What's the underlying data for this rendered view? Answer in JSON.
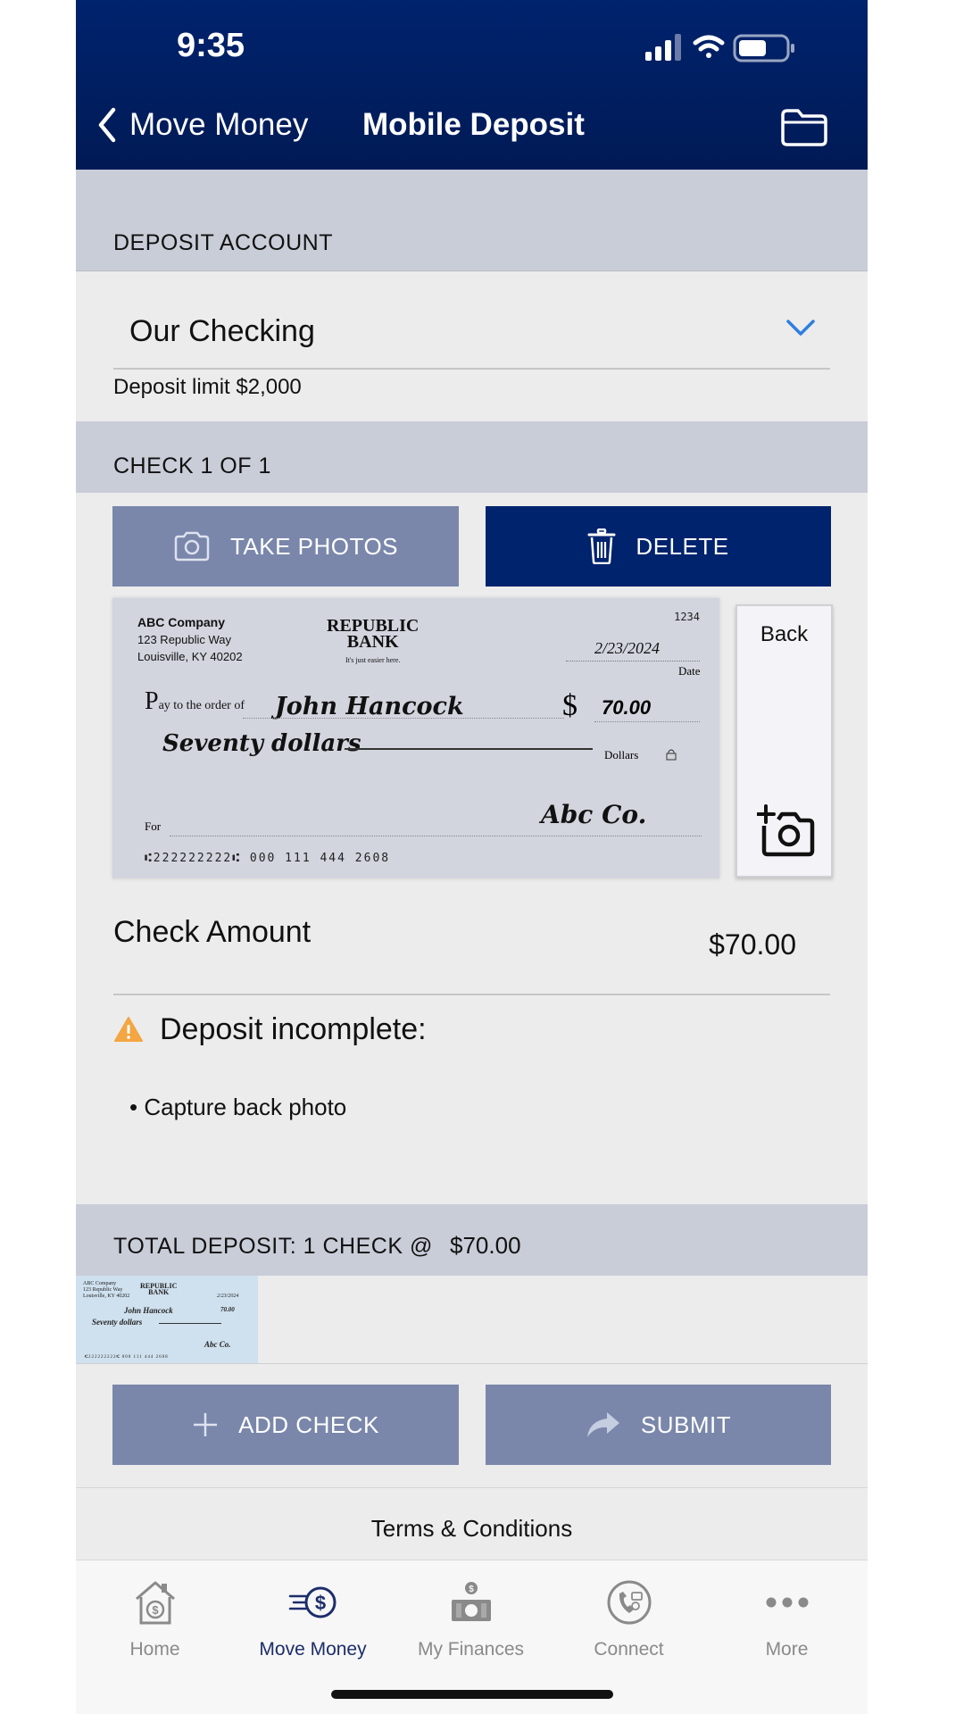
{
  "status_bar": {
    "time": "9:35"
  },
  "nav": {
    "back_label": "Move Money",
    "title": "Mobile Deposit"
  },
  "deposit_account": {
    "section_label": "DEPOSIT ACCOUNT",
    "selected_account": "Our Checking",
    "deposit_limit": "Deposit limit $2,000"
  },
  "check_section": {
    "label": "CHECK 1 OF 1"
  },
  "buttons": {
    "take_photos": "TAKE PHOTOS",
    "delete": "DELETE",
    "add_check": "ADD CHECK",
    "submit": "SUBMIT"
  },
  "check_image": {
    "company_name": "ABC Company",
    "address_line1": "123 Republic Way",
    "address_line2": "Louisville, KY 40202",
    "bank_name_line1": "REPUBLIC",
    "bank_name_line2": "BANK",
    "bank_tagline": "It's just easier here.",
    "check_number": "1234",
    "date": "2/23/2024",
    "date_label": "Date",
    "pay_prefix": "P",
    "pay_to_label": "ay to the order of",
    "payee": "John Hancock",
    "currency_symbol": "$",
    "amount": "70.00",
    "amount_words": "Seventy dollars",
    "dollars_label": "Dollars",
    "for_label": "For",
    "signature": "Abc Co.",
    "micr_line": "⑆222222222⑆ 000 111 444 2608"
  },
  "back_photo": {
    "label": "Back"
  },
  "check_amount": {
    "label": "Check Amount",
    "value": "$70.00"
  },
  "warning": {
    "title": "Deposit incomplete:",
    "items": [
      "• Capture back photo"
    ]
  },
  "total": {
    "label": "TOTAL DEPOSIT: 1 CHECK @",
    "amount": "$70.00"
  },
  "terms": "Terms & Conditions",
  "tabbar": {
    "items": [
      {
        "label": "Home",
        "icon": "home-money-icon"
      },
      {
        "label": "Move Money",
        "icon": "move-money-icon",
        "active": true
      },
      {
        "label": "My Finances",
        "icon": "finances-icon"
      },
      {
        "label": "Connect",
        "icon": "connect-phone-icon"
      },
      {
        "label": "More",
        "icon": "more-dots-icon"
      }
    ]
  },
  "colors": {
    "header_bg": "#00236e",
    "primary_button": "#00236e",
    "secondary_button": "#7a87ab",
    "section_band": "#c9cdd8",
    "page_bg": "#ececec",
    "accent": "#2f7ee0",
    "warning": "#f3a641",
    "active_tab": "#1c2d6b"
  }
}
